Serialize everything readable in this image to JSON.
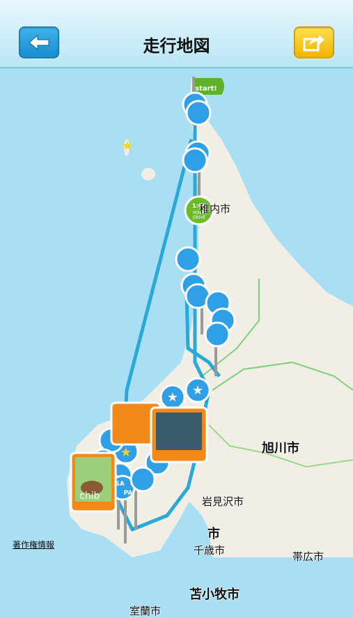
{
  "header": {
    "title": "走行地図",
    "back_icon": "arrow-left-icon",
    "share_icon": "share-arrow-icon"
  },
  "map": {
    "flag_text": "start!",
    "badge_text": [
      "1:00",
      "HOUR",
      "DRIVE"
    ],
    "cities": {
      "wakkanai": "稚内市",
      "asahikawa": "旭川市",
      "iwamizawa": "岩見沢市",
      "sapporo": "市",
      "chitose": "千歳市",
      "obihiro": "帯広市",
      "tomakomai": "苫小牧市",
      "muroran": "室蘭市"
    },
    "photo_caption": "chib",
    "sa_labels": [
      "SA",
      "SA",
      "PA"
    ],
    "credit": "著作権情報",
    "colors": {
      "route": "#2aa8d8",
      "pin": "#2f9fe6",
      "land": "#f1eee5",
      "sea": "#a8dff4",
      "photo_frame": "#f28a1a",
      "drive_badge": "#6cbb2a"
    }
  }
}
